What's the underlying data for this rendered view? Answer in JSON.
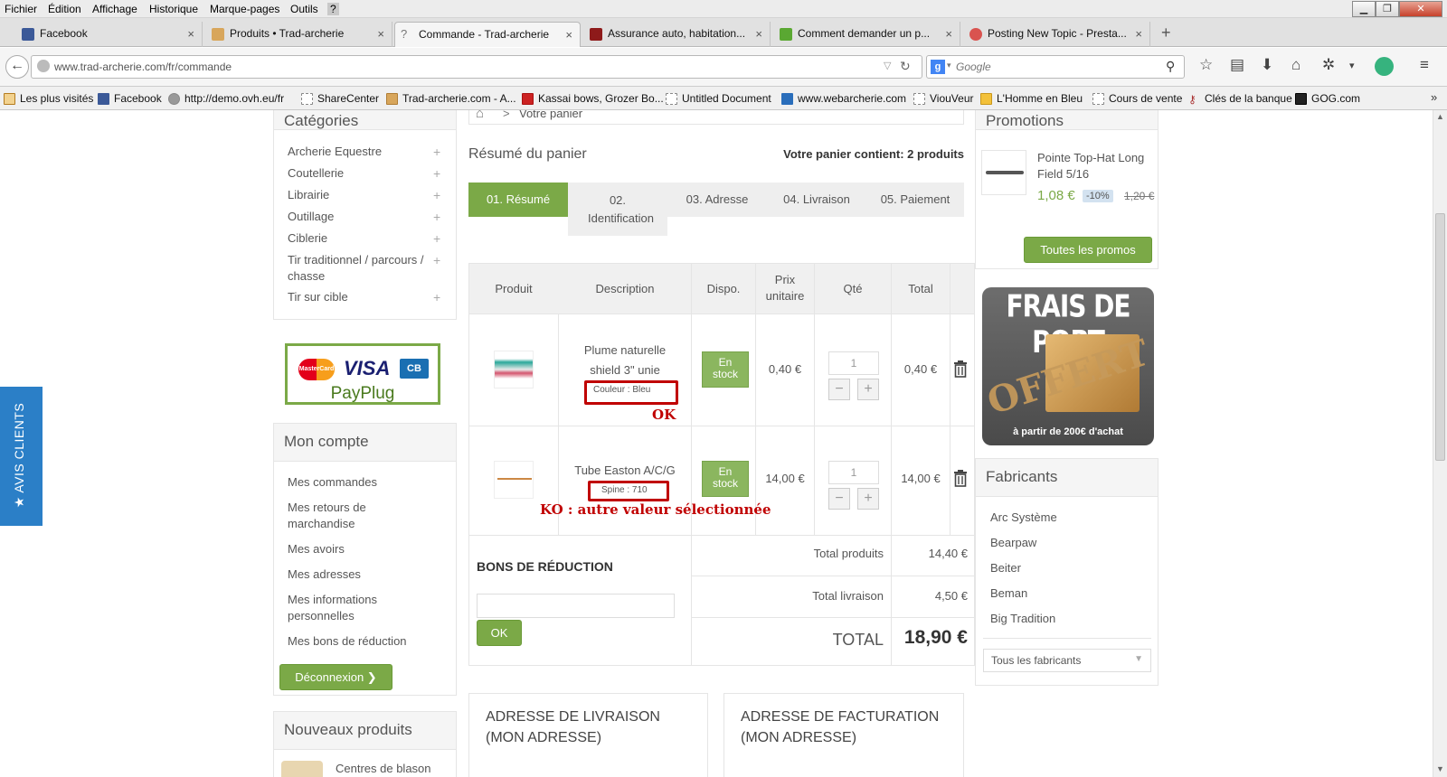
{
  "menubar": {
    "items": [
      "Fichier",
      "Édition",
      "Affichage",
      "Historique",
      "Marque-pages",
      "Outils",
      "?"
    ]
  },
  "tabs": [
    {
      "label": "Facebook",
      "close": "×"
    },
    {
      "label": "Produits • Trad-archerie",
      "close": "×"
    },
    {
      "label": "Commande - Trad-archerie",
      "close": "×"
    },
    {
      "label": "Assurance auto, habitation...",
      "close": "×"
    },
    {
      "label": "Comment demander un p...",
      "close": "×"
    },
    {
      "label": "Posting New Topic - Presta...",
      "close": "×"
    }
  ],
  "new_tab": "+",
  "address": {
    "url": "www.trad-archerie.com/fr/commande"
  },
  "search": {
    "placeholder": "Google"
  },
  "bookmarks": [
    "Les plus visités",
    "Facebook",
    "http://demo.ovh.eu/fr",
    "ShareCenter",
    "Trad-archerie.com - A...",
    "Kassai bows, Grozer Bo...",
    "Untitled Document",
    "www.webarcherie.com",
    "ViouVeur",
    "L'Homme en Bleu",
    "Cours de vente",
    "Clés de la banque",
    "GOG.com"
  ],
  "bookmarks_more": "»",
  "side_tab": {
    "label": "★ AVIS CLIENTS"
  },
  "categories": {
    "title": "Catégories",
    "items": [
      "Archerie Equestre",
      "Coutellerie",
      "Librairie",
      "Outillage",
      "Ciblerie",
      "Tir traditionnel / parcours / chasse",
      "Tir sur cible"
    ],
    "expand": "+"
  },
  "payment_logo": {
    "mastercard": "MasterCard",
    "visa": "VISA",
    "cb": "CB",
    "brand": "PayPlug"
  },
  "account": {
    "title": "Mon compte",
    "items": [
      "Mes commandes",
      "Mes retours de marchandise",
      "Mes avoirs",
      "Mes adresses",
      "Mes informations personnelles",
      "Mes bons de réduction"
    ],
    "logout": "Déconnexion ❯"
  },
  "new_products": {
    "title": "Nouveaux produits",
    "item": "Centres de blason"
  },
  "breadcrumb": {
    "current": "Votre panier",
    "sep": ">"
  },
  "cart": {
    "title": "Résumé du panier",
    "count": "Votre panier contient: 2 produits",
    "steps": [
      "01. Résumé",
      "02. Identification",
      "03. Adresse",
      "04. Livraison",
      "05. Paiement"
    ],
    "headers": {
      "product": "Produit",
      "description": "Description",
      "dispo": "Dispo.",
      "unit": "Prix unitaire",
      "qty": "Qté",
      "total": "Total"
    },
    "rows": [
      {
        "name": "Plume naturelle shield 3\" unie",
        "attr": "Couleur : Bleu",
        "stock": "En stock",
        "unit": "0,40 €",
        "qty": "1",
        "total": "0,40 €",
        "note": "OK"
      },
      {
        "name": "Tube Easton A/C/G",
        "attr": "Spine : 710",
        "stock": "En stock",
        "unit": "14,00 €",
        "qty": "1",
        "total": "14,00 €",
        "note": "KO : autre valeur sélectionnée"
      }
    ],
    "minus": "−",
    "plus": "+",
    "voucher": {
      "title": "BONS DE RÉDUCTION",
      "button": "OK"
    },
    "totals": {
      "products_label": "Total produits",
      "products": "14,40 €",
      "shipping_label": "Total livraison",
      "shipping": "4,50 €",
      "total_label": "TOTAL",
      "total": "18,90 €"
    }
  },
  "addresses": {
    "delivery": "ADRESSE DE LIVRAISON (MON ADRESSE)",
    "billing": "ADRESSE DE FACTURATION (MON ADRESSE)"
  },
  "promotions": {
    "title": "Promotions",
    "product": "Pointe Top-Hat Long Field 5/16",
    "price": "1,08 €",
    "discount": "-10%",
    "old_price": "1,20 €",
    "button": "Toutes les promos"
  },
  "shipping_banner": {
    "line1": "FRAIS DE PORT",
    "line2": "OFFERT",
    "line3": "à partir de 200€ d'achat"
  },
  "manufacturers": {
    "title": "Fabricants",
    "items": [
      "Arc Système",
      "Bearpaw",
      "Beiter",
      "Beman",
      "Big Tradition"
    ],
    "select": "Tous les fabricants"
  }
}
